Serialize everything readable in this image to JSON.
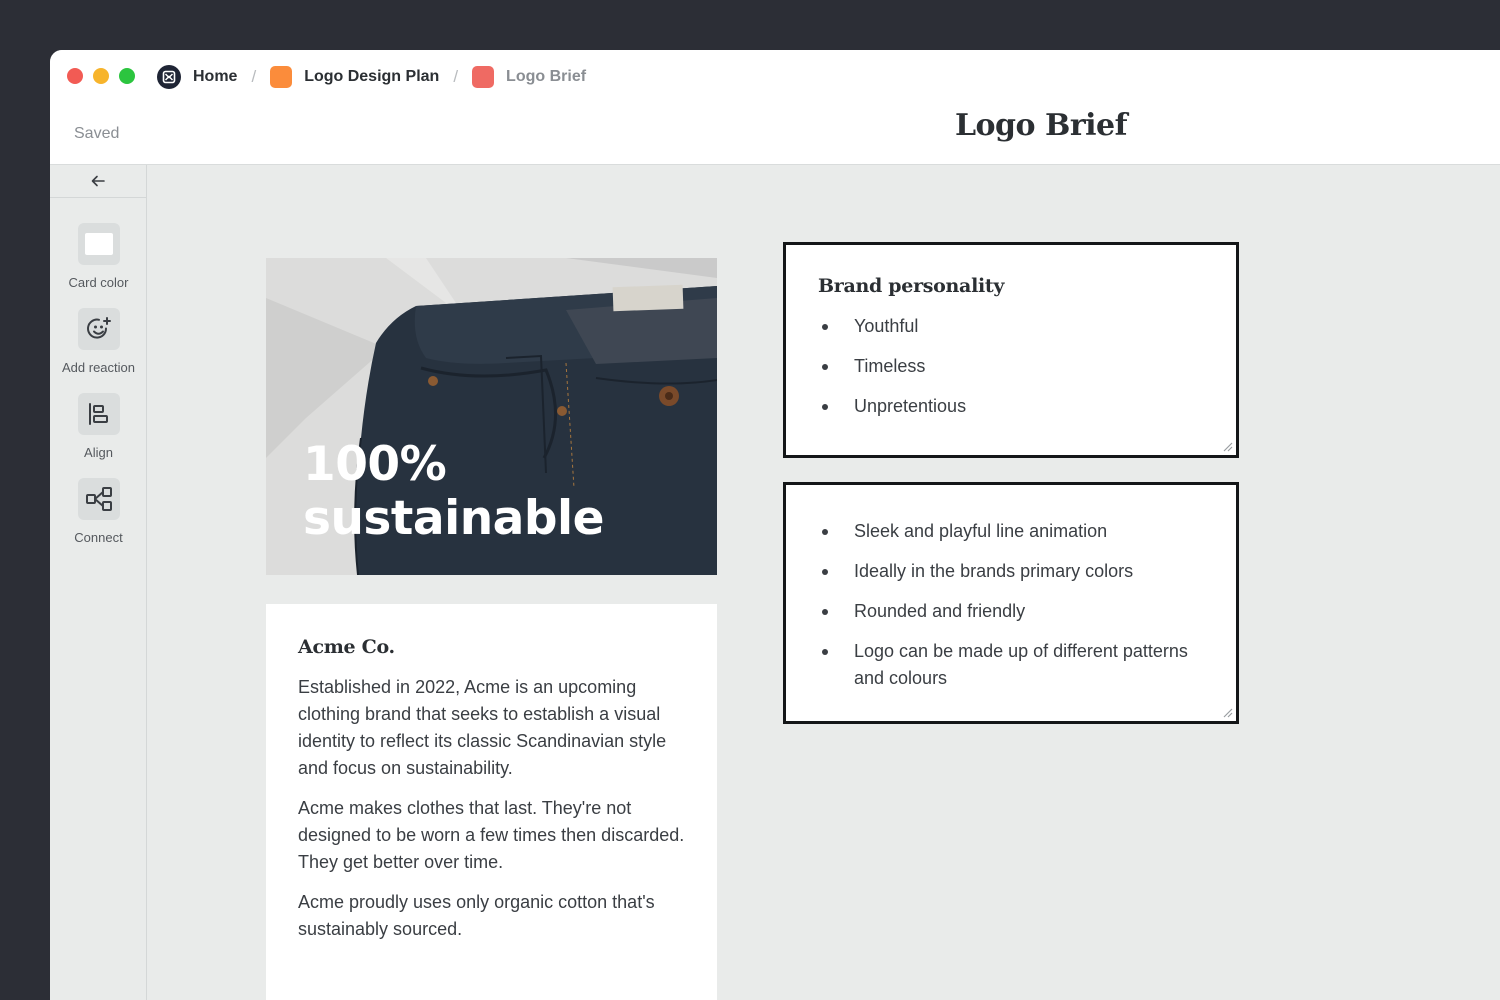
{
  "breadcrumb": {
    "home": "Home",
    "parent": "Logo Design Plan",
    "current": "Logo Brief",
    "separator": "/"
  },
  "header": {
    "status": "Saved",
    "title": "Logo Brief"
  },
  "toolbar": {
    "items": [
      {
        "label": "Card color",
        "icon": "card-color-icon"
      },
      {
        "label": "Add reaction",
        "icon": "smiley-plus-icon"
      },
      {
        "label": "Align",
        "icon": "align-left-icon"
      },
      {
        "label": "Connect",
        "icon": "connect-icon"
      }
    ]
  },
  "image_card": {
    "overlay_line1": "100%",
    "overlay_line2": "sustainable"
  },
  "company_card": {
    "title": "Acme Co.",
    "paragraphs": [
      "Established in 2022, Acme is an upcoming clothing brand that seeks to establish a visual identity to reflect its classic Scandinavian style and focus on sustainability.",
      "Acme makes clothes that last. They're not designed to be worn a few times then discarded. They get better over time.",
      "Acme proudly uses only organic cotton that's sustainably sourced."
    ]
  },
  "personality_card": {
    "title": "Brand personality",
    "items": [
      "Youthful",
      "Timeless",
      "Unpretentious"
    ]
  },
  "ideas_card": {
    "items": [
      "Sleek and playful line animation",
      "Ideally in the brands primary colors",
      "Rounded and friendly",
      "Logo can be made up of different patterns and colours"
    ]
  },
  "colors": {
    "parent_icon": "#fb8c3b",
    "current_icon": "#ef6a63",
    "card_border": "#141618"
  }
}
